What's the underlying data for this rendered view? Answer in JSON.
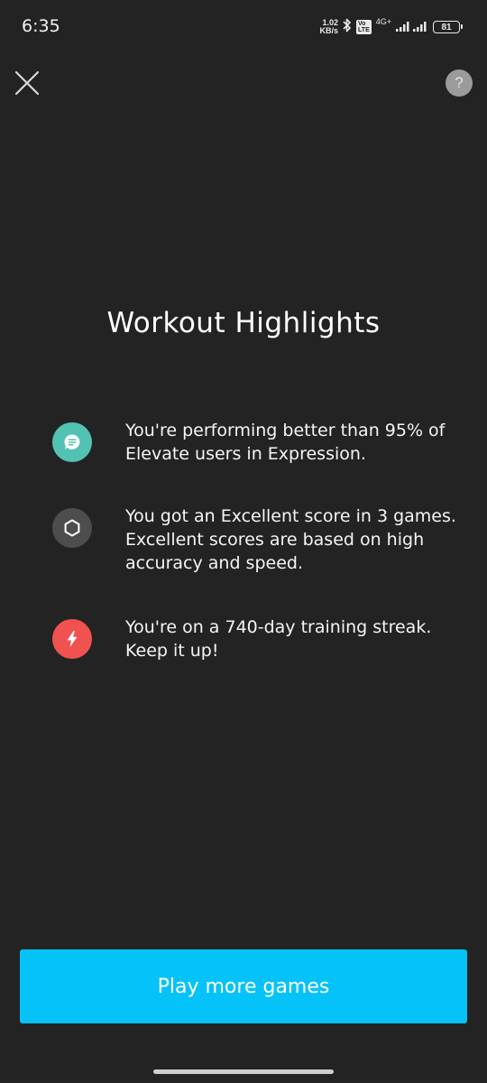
{
  "status_bar": {
    "time": "6:35",
    "net_speed_value": "1.02",
    "net_speed_unit": "KB/s",
    "volte_top": "Vo",
    "volte_bottom": "LTE",
    "network_type": "4G+",
    "battery_level": "81",
    "icons": [
      "bluetooth-icon",
      "volte-icon",
      "signal-icon",
      "battery-icon"
    ]
  },
  "header": {
    "close_icon": "close-icon",
    "help_label": "?"
  },
  "main": {
    "title": "Workout Highlights",
    "highlights": [
      {
        "icon": "speech-bubble-icon",
        "icon_color": "#52c2b4",
        "text": "You're performing better than 95% of Elevate users in Expression."
      },
      {
        "icon": "hexagon-icon",
        "icon_color": "#4d4d4d",
        "text": "You got an Excellent score in 3 games. Excellent scores are based on high accuracy and speed."
      },
      {
        "icon": "lightning-bolt-icon",
        "icon_color": "#f2524f",
        "text": "You're on a 740-day training streak. Keep it up!"
      }
    ]
  },
  "footer": {
    "play_button_label": "Play more games",
    "button_color": "#05c3f9"
  }
}
